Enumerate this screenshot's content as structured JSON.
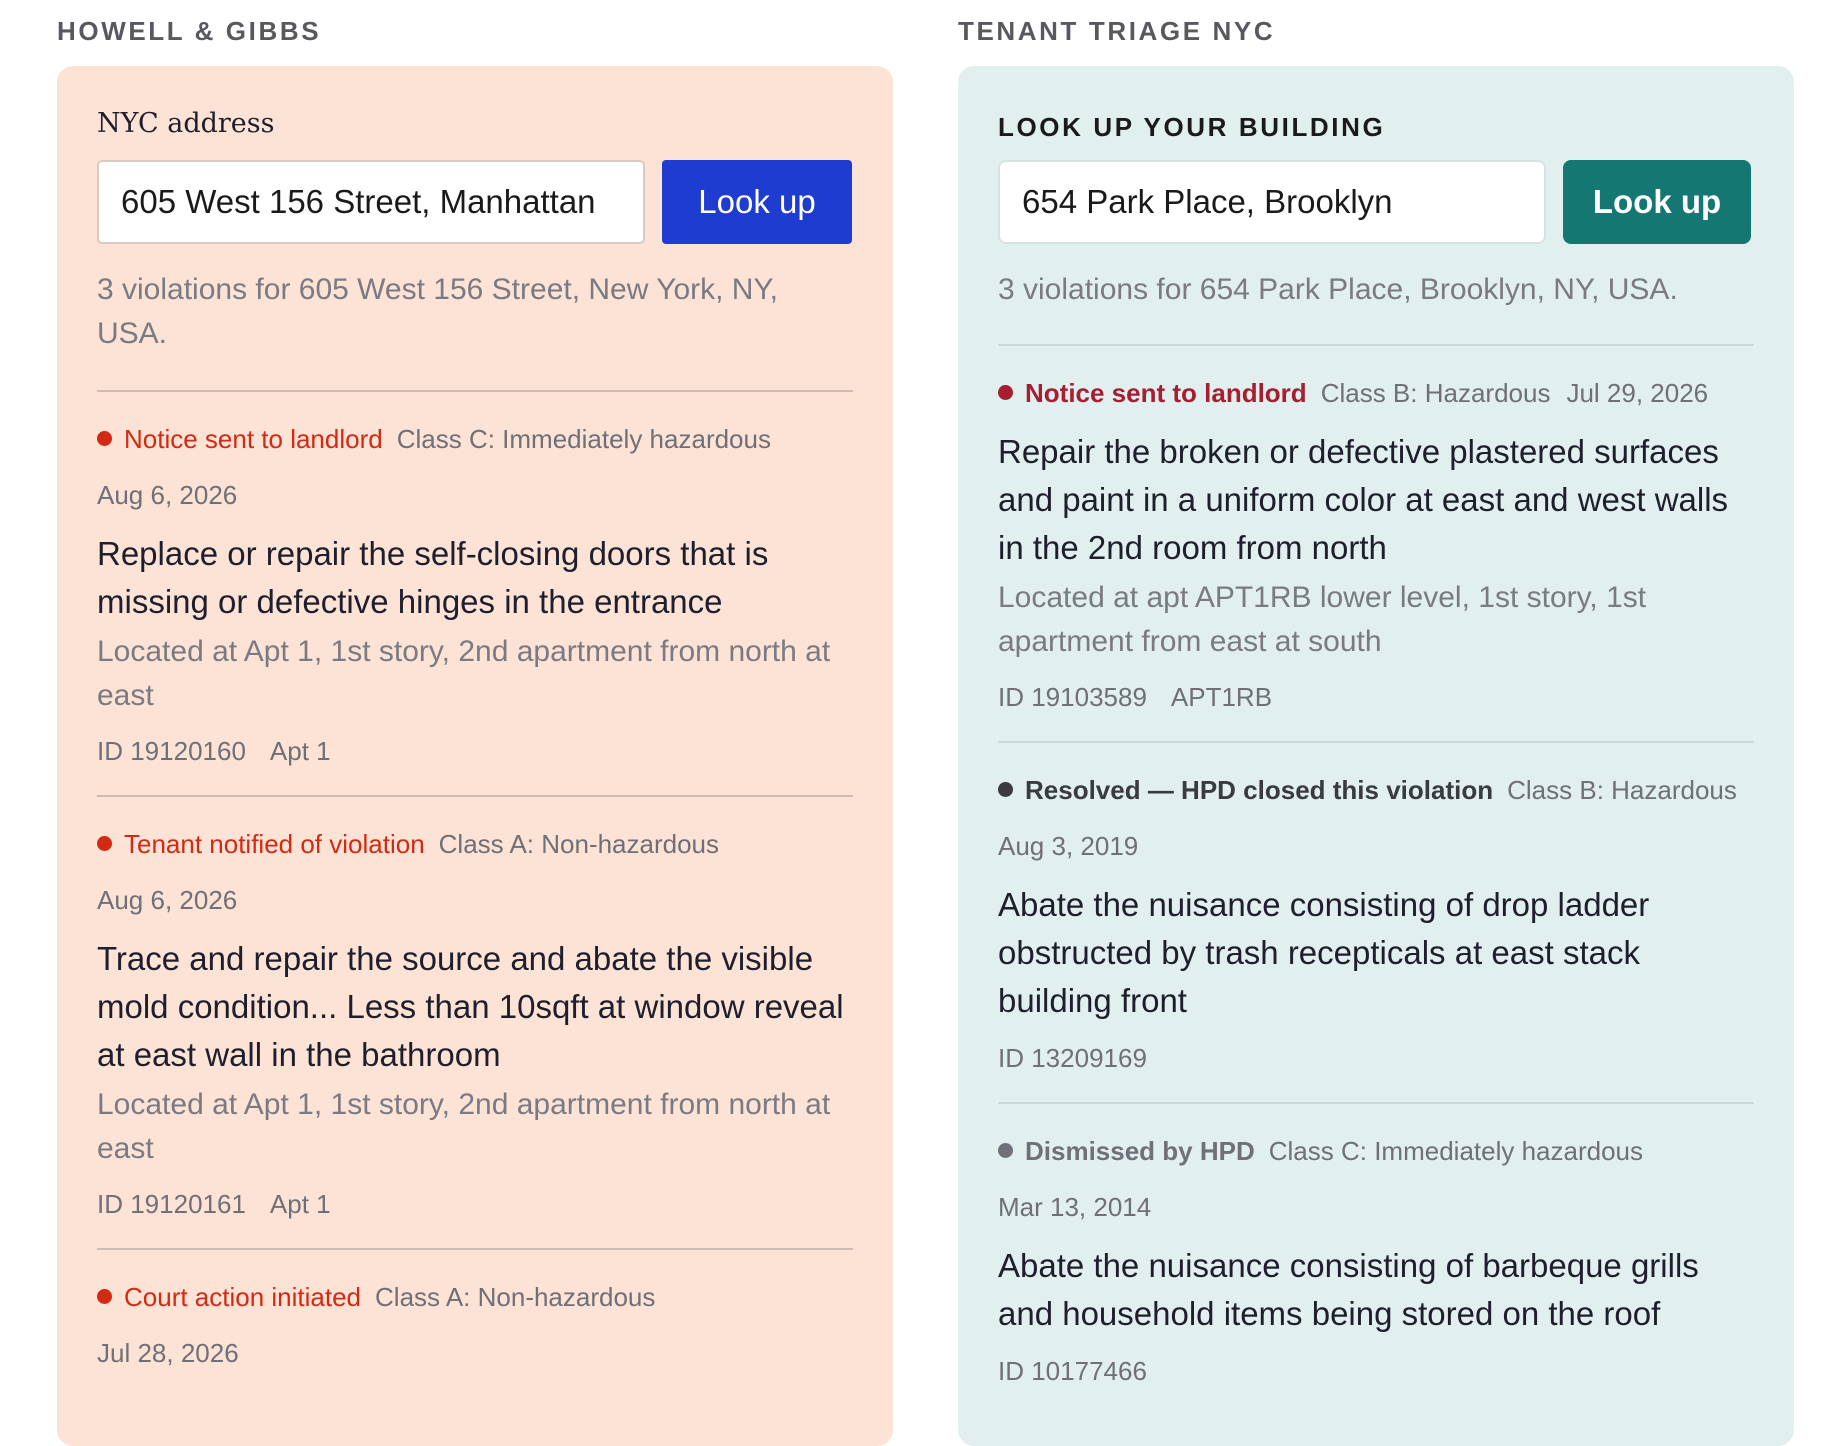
{
  "left": {
    "brand": "HOWELL & GIBBS",
    "form_label": "NYC address",
    "address_value": "605 West 156 Street, Manhattan",
    "button_label": "Look up",
    "summary": "3 violations for 605 West 156 Street, New York, NY, USA.",
    "violations": [
      {
        "status": "Notice sent to landlord",
        "class": "Class C: Immediately hazardous",
        "date": "Aug 6, 2026",
        "description": "Replace or repair the self-closing doors that is missing or defective hinges in the entrance",
        "location": "Located at Apt 1, 1st story, 2nd apartment from north at east",
        "id": "ID 19120160",
        "apt": "Apt 1"
      },
      {
        "status": "Tenant notified of violation",
        "class": "Class A: Non-hazardous",
        "date": "Aug 6, 2026",
        "description": "Trace and repair the source and abate the visible mold condition... Less than 10sqft at window reveal at east wall in the bathroom",
        "location": "Located at Apt 1, 1st story, 2nd apartment from north at east",
        "id": "ID 19120161",
        "apt": "Apt 1"
      },
      {
        "status": "Court action initiated",
        "class": "Class A: Non-hazardous",
        "date": "Jul 28, 2026"
      }
    ]
  },
  "right": {
    "brand": "TENANT TRIAGE NYC",
    "form_label": "LOOK UP YOUR BUILDING",
    "address_value": "654 Park Place, Brooklyn",
    "button_label": "Look up",
    "summary": "3 violations for 654 Park Place, Brooklyn, NY, USA.",
    "violations": [
      {
        "status": "Notice sent to landlord",
        "class": "Class B: Hazardous",
        "date": "Jul 29, 2026",
        "description": "Repair the broken or defective plastered surfaces and paint in a uniform color at east and west walls in the 2nd room from north",
        "location": "Located at apt APT1RB lower level, 1st story, 1st apartment from east at south",
        "id": "ID 19103589",
        "apt": "APT1RB"
      },
      {
        "status": "Resolved — HPD closed this violation",
        "class": "Class B: Hazardous",
        "date": "Aug 3, 2019",
        "description": "Abate the nuisance consisting of drop ladder obstructed by trash recepticals at east stack building front",
        "id": "ID 13209169"
      },
      {
        "status": "Dismissed by HPD",
        "class": "Class C: Immediately hazardous",
        "date": "Mar 13, 2014",
        "description": "Abate the nuisance consisting of barbeque grills and household items being stored on the roof",
        "id": "ID 10177466"
      }
    ]
  },
  "colors": {
    "left_panel": "#fde2d6",
    "right_panel": "#e1efee",
    "left_button": "#1f3cd0",
    "right_button": "#147772",
    "status_red": "#d32a14",
    "status_maroon": "#a51f30"
  }
}
